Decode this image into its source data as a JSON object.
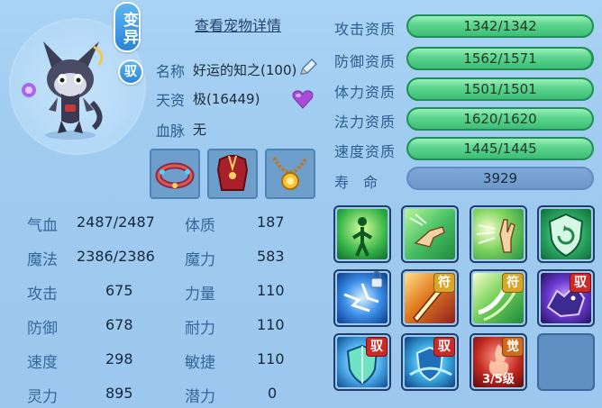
{
  "pet": {
    "variant_badge": "变异",
    "ride_badge": "驭",
    "details_link": "查看宠物详情",
    "name_label": "名称",
    "name_value": "好运的知之(100)",
    "aptitude_label": "天资",
    "aptitude_value": "极(16449)",
    "bloodline_label": "血脉",
    "bloodline_value": "无"
  },
  "attributes": {
    "left": [
      {
        "label": "气血",
        "value": "2487/2487"
      },
      {
        "label": "魔法",
        "value": "2386/2386"
      },
      {
        "label": "攻击",
        "value": "675"
      },
      {
        "label": "防御",
        "value": "678"
      },
      {
        "label": "速度",
        "value": "298"
      },
      {
        "label": "灵力",
        "value": "895"
      }
    ],
    "right": [
      {
        "label": "体质",
        "value": "187"
      },
      {
        "label": "魔力",
        "value": "583"
      },
      {
        "label": "力量",
        "value": "110"
      },
      {
        "label": "耐力",
        "value": "110"
      },
      {
        "label": "敏捷",
        "value": "110"
      },
      {
        "label": "潜力",
        "value": "0"
      }
    ]
  },
  "aptitudes": [
    {
      "label": "攻击资质",
      "value": "1342/1342",
      "fill": 1.0
    },
    {
      "label": "防御资质",
      "value": "1562/1571",
      "fill": 0.994
    },
    {
      "label": "体力资质",
      "value": "1501/1501",
      "fill": 1.0
    },
    {
      "label": "法力资质",
      "value": "1620/1620",
      "fill": 1.0
    },
    {
      "label": "速度资质",
      "value": "1445/1445",
      "fill": 1.0
    }
  ],
  "lifespan": {
    "label": "寿　命",
    "value": "3929"
  },
  "skills": {
    "fu_tag": "符",
    "yu_tag": "驭",
    "jue_tag": "觉",
    "awaken_level": "3/5级"
  },
  "icons": {
    "pencil": "pencil-edit-icon",
    "heart": "purple-heart-icon"
  },
  "colors": {
    "accent": "#2a84d8",
    "bar_green": "#3cbd75",
    "heart": "#a64cd8"
  }
}
